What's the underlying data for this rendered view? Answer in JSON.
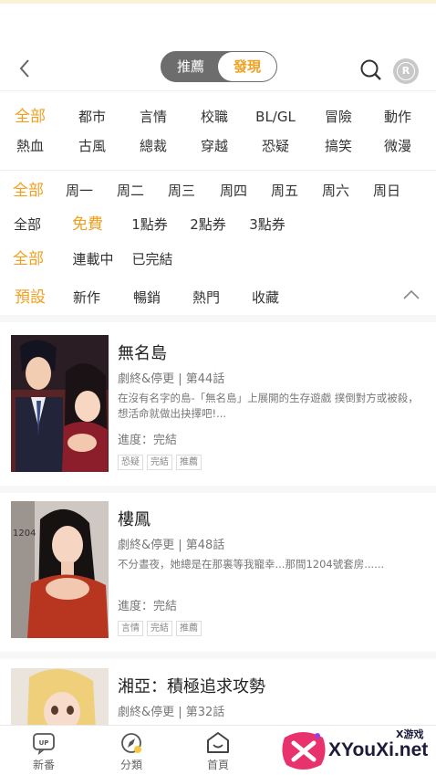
{
  "header": {
    "tabs": [
      {
        "label": "推薦",
        "active": false
      },
      {
        "label": "發現",
        "active": true
      }
    ],
    "icons": [
      "back-arrow-icon",
      "search-icon",
      "r-badge-icon"
    ],
    "badge_letter": "R"
  },
  "filters": {
    "genre_row1": [
      "全部",
      "都市",
      "言情",
      "校職",
      "BL/GL",
      "冒險",
      "動作"
    ],
    "genre_row2": [
      "熱血",
      "古風",
      "總裁",
      "穿越",
      "恐疑",
      "搞笑",
      "微漫"
    ],
    "weekday": [
      "全部",
      "周一",
      "周二",
      "周三",
      "周四",
      "周五",
      "周六",
      "周日"
    ],
    "price": [
      "全部",
      "免費",
      "1點券",
      "2點券",
      "3點券"
    ],
    "status": [
      "全部",
      "連載中",
      "已完結"
    ],
    "sort": [
      "預設",
      "新作",
      "暢銷",
      "熱門",
      "收藏"
    ]
  },
  "comics": [
    {
      "title": "無名島",
      "meta": "劇終&停更 | 第44話",
      "desc": "在沒有名字的島-「無名島」上展開的生存遊戲 撲倒對方或被殺，想活命就做出抉擇吧!...",
      "progress": "進度：完結",
      "tags": [
        "恐疑",
        "完結",
        "推薦"
      ]
    },
    {
      "title": "樓鳳",
      "meta": "劇終&停更 | 第48話",
      "desc": "不分晝夜，她總是在那裏等我寵幸...那間1204號套房......",
      "progress": "進度：完結",
      "tags": [
        "言情",
        "完結",
        "推薦"
      ],
      "cover_text": "1204"
    },
    {
      "title": "湘亞：積極追求攻勢",
      "meta": "劇終&停更 | 第32話"
    }
  ],
  "tabbar": [
    {
      "label": "新番",
      "icon": "up-icon"
    },
    {
      "label": "分類",
      "icon": "compass-icon"
    },
    {
      "label": "首頁",
      "icon": "home-face-icon"
    }
  ],
  "watermark": {
    "text": "XYouXi.net",
    "sub": "X游戏"
  },
  "colors": {
    "accent": "#f0a020",
    "segment_bg": "#6d6d6d",
    "text": "#333333",
    "muted": "#777777"
  }
}
